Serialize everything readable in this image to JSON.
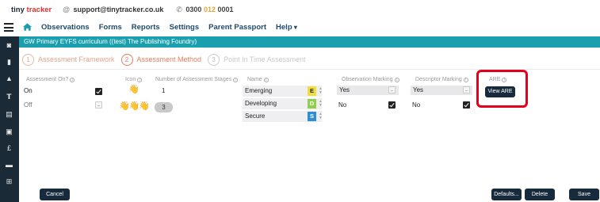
{
  "brand": {
    "logo_part1": "tiny",
    "logo_part2": "tracker",
    "email": "support@tinytracker.co.uk",
    "phone_prefix": "0300 ",
    "phone_highlight": "012",
    "phone_suffix": " 0001"
  },
  "nav": {
    "items": [
      {
        "label": "Observations"
      },
      {
        "label": "Forms"
      },
      {
        "label": "Reports"
      },
      {
        "label": "Settings"
      },
      {
        "label": "Parent Passport"
      },
      {
        "label": "Help"
      }
    ]
  },
  "sidebar": {
    "icons": [
      "dashboard-icon",
      "book-icon",
      "user-icon",
      "child-icon",
      "calendar-icon",
      "chart-icon",
      "pound-icon",
      "wallet-icon",
      "plus-icon"
    ]
  },
  "curriculum_title": "GW Primary EYFS curriculum ((test) The Publishing Foundry)",
  "steps": [
    {
      "num": "1",
      "label": "Assessment Framework"
    },
    {
      "num": "2",
      "label": "Assessment Method"
    },
    {
      "num": "3",
      "label": "Point In Time Assessment"
    }
  ],
  "columns": {
    "assessment_on": "Assessment On?",
    "icon": "Icon",
    "num_stages": "Number of Assessment Stages",
    "name": "Name",
    "observation_marking": "Observation Marking",
    "descriptor_marking": "Descriptor Marking",
    "are": "ARE"
  },
  "assessment_on": [
    {
      "label": "On",
      "checked": true
    },
    {
      "label": "Off",
      "checked": false
    }
  ],
  "stages_row1_value": "1",
  "stages_row2_value": "3",
  "stage_names": [
    {
      "name": "Emerging",
      "letter": "E",
      "color": "#f0df3a"
    },
    {
      "name": "Developing",
      "letter": "D",
      "color": "#8fcf4b"
    },
    {
      "name": "Secure",
      "letter": "S",
      "color": "#2c8fd6"
    }
  ],
  "observation_marking": [
    {
      "label": "Yes",
      "checked": false
    },
    {
      "label": "No",
      "checked": true
    }
  ],
  "descriptor_marking": [
    {
      "label": "Yes",
      "checked": false
    },
    {
      "label": "No",
      "checked": true
    }
  ],
  "view_are_label": "View ARE",
  "footer": {
    "cancel": "Cancel",
    "defaults": "Defaults...",
    "delete": "Delete",
    "save": "Save"
  },
  "colors": {
    "teal": "#1a9fae",
    "navy": "#172b3d",
    "highlight": "#e3001b",
    "step_accent": "#e07f5f"
  }
}
